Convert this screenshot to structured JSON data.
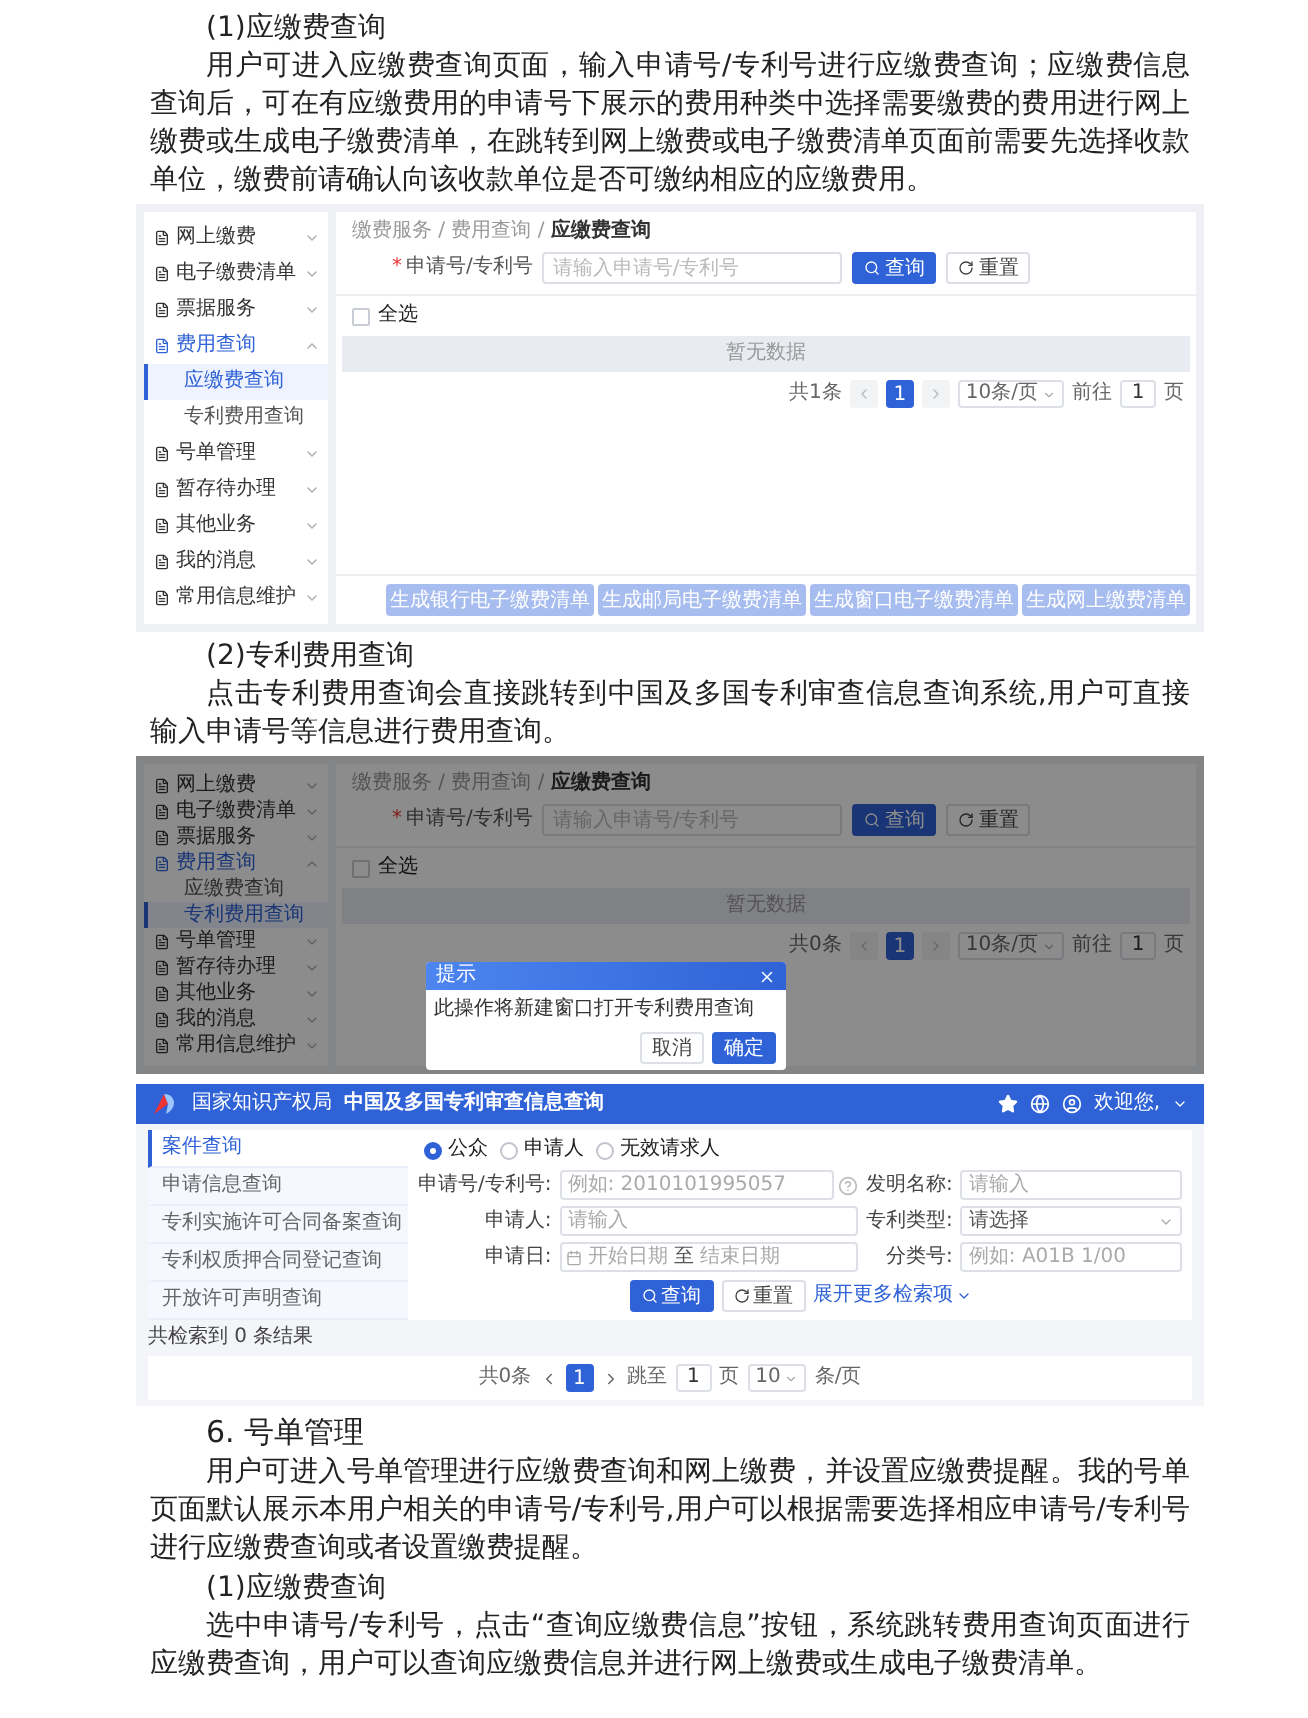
{
  "blocks": [
    {
      "kind": "subheading",
      "text": "(1)应缴费查询"
    },
    {
      "kind": "paragraph",
      "text": "用户可进入应缴费查询页面，输入申请号/专利号进行应缴费查询；应缴费信息查询后，可在有应缴费用的申请号下展示的费用种类中选择需要缴费的费用进行网上缴费或生成电子缴费清单，在跳转到网上缴费或电子缴费清单页面前需要先选择收款单位，缴费前请确认向该收款单位是否可缴纳相应的应缴费用。"
    },
    {
      "kind": "app",
      "breadcrumb": "缴费服务 / 费用查询 / **应缴费查询**",
      "sidebar": [
        {
          "label": "网上缴费",
          "expanded": false
        },
        {
          "label": "电子缴费清单",
          "expanded": false
        },
        {
          "label": "票据服务",
          "expanded": false
        },
        {
          "label": "费用查询",
          "expanded": true,
          "children": [
            {
              "label": "应缴费查询",
              "selected": true
            },
            {
              "label": "专利费用查询",
              "selected": false
            }
          ]
        },
        {
          "label": "号单管理",
          "expanded": false
        },
        {
          "label": "暂存待办理",
          "expanded": false
        },
        {
          "label": "其他业务",
          "expanded": false
        },
        {
          "label": "我的消息",
          "expanded": false
        },
        {
          "label": "常用信息维护",
          "expanded": false
        }
      ],
      "search": {
        "required_mark": "*",
        "label": "申请号/专利号",
        "placeholder": "请输入申请号/专利号"
      },
      "buttons": [
        "查询",
        "重置"
      ],
      "select_all": {
        "label": "全选",
        "checked": false
      },
      "empty_text": "暂无数据",
      "pagination": {
        "total": "共1条",
        "pages": [
          {
            "label": "1",
            "selected": true
          }
        ],
        "page_size": "10条/页",
        "goto_label": "前往",
        "goto_value": "1",
        "page_unit": "页"
      },
      "footer_buttons": [
        {
          "label": "生成银行电子缴费清单",
          "disabled": true
        },
        {
          "label": "生成邮局电子缴费清单",
          "disabled": true
        },
        {
          "label": "生成窗口电子缴费清单",
          "disabled": true
        },
        {
          "label": "生成网上缴费清单",
          "disabled": true
        }
      ]
    },
    {
      "kind": "subheading",
      "text": "(2)专利费用查询"
    },
    {
      "kind": "paragraph",
      "text": "点击专利费用查询会直接跳转到中国及多国专利审查信息查询系统,用户可直接输入申请号等信息进行费用查询。"
    },
    {
      "kind": "app",
      "breadcrumb": "缴费服务 / 费用查询 / **应缴费查询**",
      "sidebar": [
        {
          "label": "网上缴费",
          "expanded": false
        },
        {
          "label": "电子缴费清单",
          "expanded": false
        },
        {
          "label": "票据服务",
          "expanded": false
        },
        {
          "label": "费用查询",
          "expanded": true,
          "children": [
            {
              "label": "应缴费查询",
              "selected": false
            },
            {
              "label": "专利费用查询",
              "selected": true
            }
          ]
        },
        {
          "label": "号单管理",
          "expanded": false
        },
        {
          "label": "暂存待办理",
          "expanded": false
        },
        {
          "label": "其他业务",
          "expanded": false
        },
        {
          "label": "我的消息",
          "expanded": false
        },
        {
          "label": "常用信息维护",
          "expanded": false
        }
      ],
      "search": {
        "required_mark": "*",
        "label": "申请号/专利号",
        "placeholder": "请输入申请号/专利号"
      },
      "buttons": [
        "查询",
        "重置"
      ],
      "select_all": {
        "label": "全选",
        "checked": false
      },
      "empty_text": "暂无数据",
      "pagination": {
        "total": "共0条",
        "pages": [
          {
            "label": "1",
            "selected": true
          }
        ],
        "page_size": "10条/页",
        "goto_label": "前往",
        "goto_value": "1",
        "page_unit": "页"
      },
      "dialog": {
        "title": "提示",
        "message": "此操作将新建窗口打开专利费用查询",
        "buttons": [
          {
            "label": "取消",
            "primary": false
          },
          {
            "label": "确定",
            "primary": true
          }
        ]
      }
    },
    {
      "kind": "portal",
      "org": "国家知识产权局",
      "title": "中国及多国专利审查信息查询",
      "user": "欢迎您,",
      "tabs": [
        {
          "label": "案件查询",
          "selected": true
        },
        {
          "label": "申请信息查询",
          "selected": false
        },
        {
          "label": "专利实施许可合同备案查询",
          "selected": false
        },
        {
          "label": "专利权质押合同登记查询",
          "selected": false
        },
        {
          "label": "开放许可声明查询",
          "selected": false
        }
      ],
      "roles": [
        {
          "label": "公众",
          "selected": true
        },
        {
          "label": "申请人",
          "selected": false
        },
        {
          "label": "无效请求人",
          "selected": false
        }
      ],
      "fields": [
        {
          "kind": "text",
          "label": "申请号/专利号:",
          "placeholder": "例如: 2010101995057",
          "help": true
        },
        {
          "kind": "text",
          "label": "发明名称:",
          "placeholder": "请输入",
          "help": false
        },
        {
          "kind": "text",
          "label": "申请人:",
          "placeholder": "请输入",
          "help": false
        },
        {
          "kind": "select",
          "label": "专利类型:",
          "placeholder": "请选择"
        },
        {
          "kind": "date_range",
          "label": "申请日:",
          "start": "开始日期",
          "separator": "至",
          "end": "结束日期"
        },
        {
          "kind": "text",
          "label": "分类号:",
          "placeholder": "例如: A01B 1/00",
          "help": false
        }
      ],
      "buttons": [
        "查询",
        "重置"
      ],
      "more_link": "展开更多检索项",
      "result_label": "共检索到 0 条结果",
      "pagination": {
        "total": "共0条",
        "pages": [
          {
            "label": "1",
            "selected": true
          }
        ],
        "goto_label": "跳至",
        "goto_value": "1",
        "page_unit": "页",
        "page_size": "10",
        "page_size_unit": "条/页"
      }
    },
    {
      "kind": "section",
      "text": "6. 号单管理"
    },
    {
      "kind": "paragraph",
      "text": "用户可进入号单管理进行应缴费查询和网上缴费，并设置应缴费提醒。我的号单页面默认展示本用户相关的申请号/专利号,用户可以根据需要选择相应申请号/专利号进行应缴费查询或者设置缴费提醒。"
    },
    {
      "kind": "subheading",
      "text": "(1)应缴费查询"
    },
    {
      "kind": "paragraph",
      "text": "选中申请号/专利号，点击“查询应缴费信息”按钮，系统跳转费用查询页面进行应缴费查询，用户可以查询应缴费信息并进行网上缴费或生成电子缴费清单。"
    }
  ]
}
